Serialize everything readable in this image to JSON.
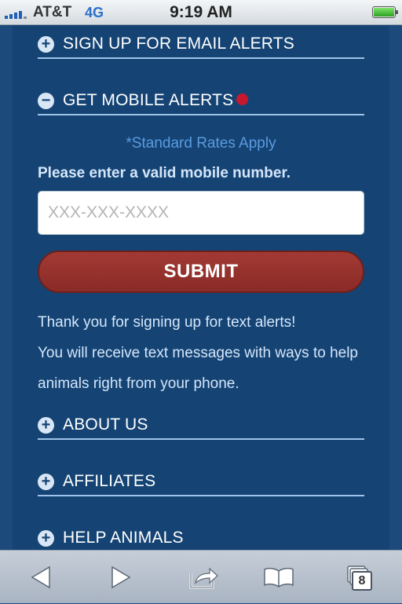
{
  "status": {
    "carrier": "AT&T",
    "network": "4G",
    "time": "9:19 AM",
    "battery_level": 1.0
  },
  "accordion": {
    "email_alerts": {
      "label": "SIGN UP FOR EMAIL ALERTS",
      "icon": "plus-icon"
    },
    "mobile_alerts": {
      "label": "GET MOBILE ALERTS",
      "icon": "minus-icon"
    },
    "about": {
      "label": "ABOUT US",
      "icon": "plus-icon"
    },
    "affiliates": {
      "label": "AFFILIATES",
      "icon": "plus-icon"
    },
    "help_animals": {
      "label": "HELP ANIMALS",
      "icon": "plus-icon"
    }
  },
  "mobile_form": {
    "rates_note": "*Standard Rates Apply",
    "prompt": "Please enter a valid mobile number.",
    "phone_placeholder": "XXX-XXX-XXXX",
    "submit_label": "SUBMIT",
    "thanks_line1": "Thank you for signing up for text alerts!",
    "thanks_line2": "You will receive text messages with ways to help animals right from your phone."
  },
  "toolbar": {
    "tab_count": "8",
    "icons": [
      "back-icon",
      "forward-icon",
      "share-icon",
      "bookmarks-icon",
      "tabs-icon"
    ]
  },
  "colors": {
    "background": "#1d4a7c",
    "panel": "#154474",
    "submit": "#962f2b",
    "alert_dot": "#c7182d",
    "rates_text": "#5a9be0"
  }
}
